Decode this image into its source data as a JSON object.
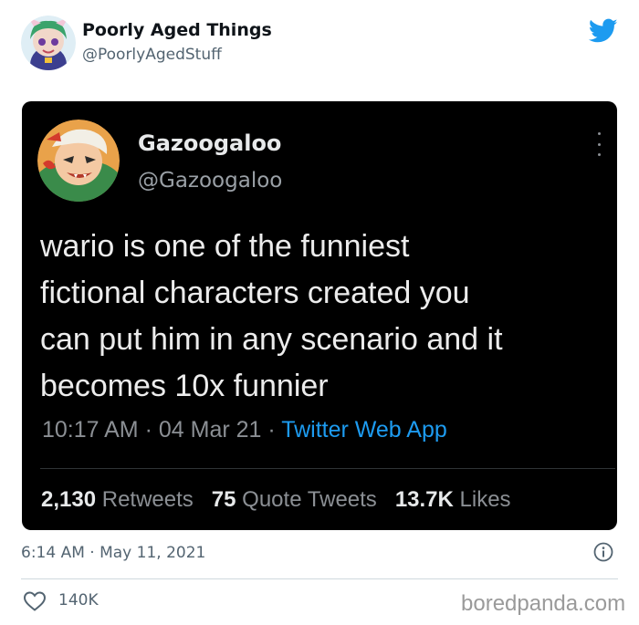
{
  "tweet": {
    "author": {
      "name": "Poorly Aged Things",
      "handle": "@PoorlyAgedStuff"
    },
    "timestamp": "6:14 AM · May 11, 2021",
    "likes": "140K"
  },
  "quoted_tweet": {
    "author": {
      "name": "Gazoogaloo",
      "handle": "@Gazoogaloo"
    },
    "body_lines": [
      "wario is one of the funniest",
      "fictional characters created you",
      "can put him in any scenario and it",
      "becomes 10x funnier"
    ],
    "time": "10:17 AM",
    "date": "04 Mar 21",
    "separator": " · ",
    "app": "Twitter Web App",
    "stats": {
      "retweets": {
        "count": "2,130",
        "label": "Retweets"
      },
      "quotes": {
        "count": "75",
        "label": "Quote Tweets"
      },
      "likes": {
        "count": "13.7K",
        "label": "Likes"
      }
    }
  },
  "watermark": "boredpanda.com",
  "colors": {
    "twitter_blue": "#1d9bf0",
    "quoted_background": "#000000",
    "muted_text": "#536471"
  },
  "icons": [
    "twitter-bird-icon",
    "more-options-icon",
    "info-icon",
    "heart-icon"
  ]
}
